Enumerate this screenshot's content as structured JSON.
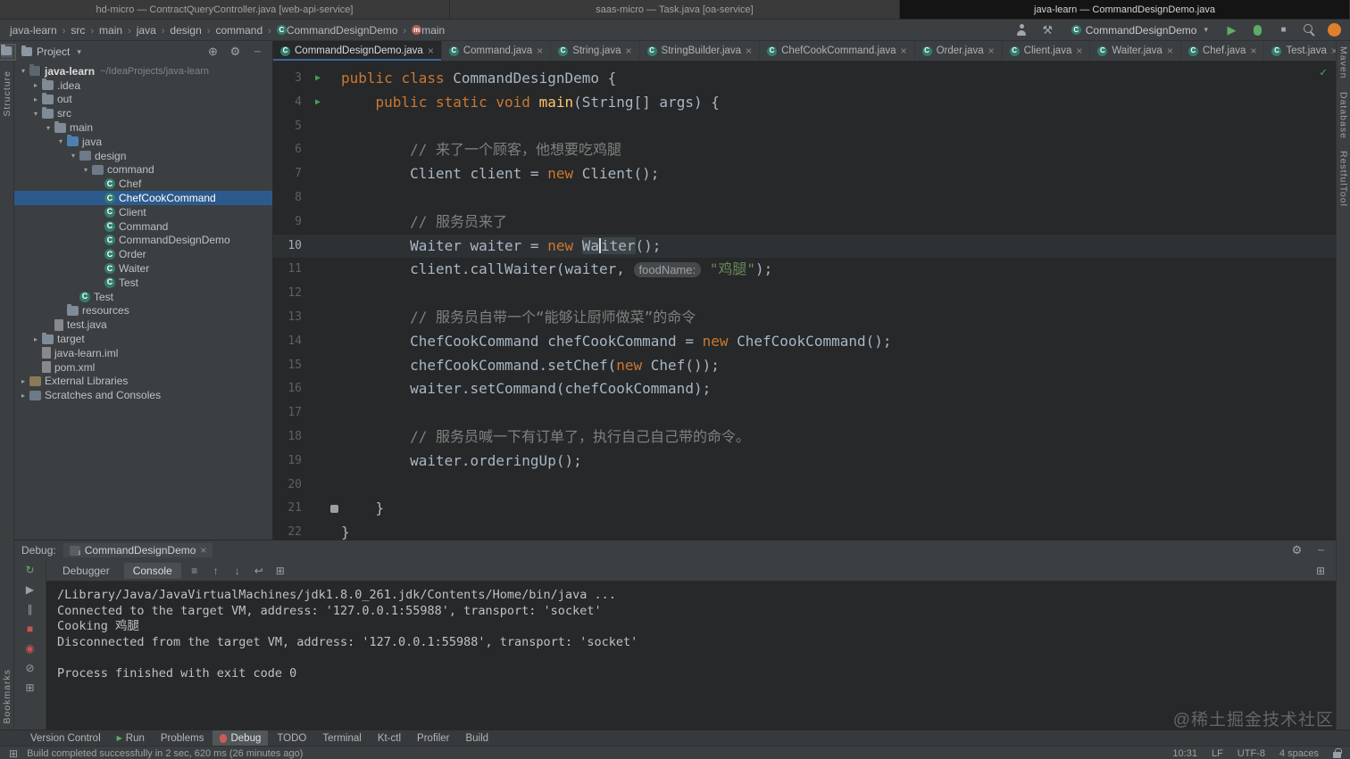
{
  "titlebar": {
    "windows": [
      {
        "label": "hd-micro — ContractQueryController.java [web-api-service]",
        "active": false
      },
      {
        "label": "saas-micro — Task.java [oa-service]",
        "active": false
      },
      {
        "label": "java-learn — CommandDesignDemo.java",
        "active": true
      }
    ]
  },
  "navbar": {
    "breadcrumbs": [
      {
        "label": "java-learn"
      },
      {
        "label": "src"
      },
      {
        "label": "main"
      },
      {
        "label": "java"
      },
      {
        "label": "design"
      },
      {
        "label": "command"
      },
      {
        "label": "CommandDesignDemo",
        "icon": "class"
      },
      {
        "label": "main",
        "icon": "method"
      }
    ],
    "run_config": "CommandDesignDemo"
  },
  "left_strip": {
    "structure_label": "Structure",
    "bookmarks_label": "Bookmarks"
  },
  "right_strip": {
    "labels": [
      "Maven",
      "Database",
      "RestfulTool"
    ]
  },
  "project": {
    "header_label": "Project",
    "tree": [
      {
        "label": "java-learn",
        "hint": "~/IdeaProjects/java-learn",
        "depth": 0,
        "chev": "open",
        "icon": "project",
        "bold": true
      },
      {
        "label": ".idea",
        "depth": 1,
        "chev": "closed",
        "icon": "folder"
      },
      {
        "label": "out",
        "depth": 1,
        "chev": "closed",
        "icon": "folder"
      },
      {
        "label": "src",
        "depth": 1,
        "chev": "open",
        "icon": "folder"
      },
      {
        "label": "main",
        "depth": 2,
        "chev": "open",
        "icon": "folder"
      },
      {
        "label": "java",
        "depth": 3,
        "chev": "open",
        "icon": "folder-src"
      },
      {
        "label": "design",
        "depth": 4,
        "chev": "open",
        "icon": "package"
      },
      {
        "label": "command",
        "depth": 5,
        "chev": "open",
        "icon": "package"
      },
      {
        "label": "Chef",
        "depth": 6,
        "icon": "class"
      },
      {
        "label": "ChefCookCommand",
        "depth": 6,
        "icon": "class",
        "selected": true
      },
      {
        "label": "Client",
        "depth": 6,
        "icon": "class"
      },
      {
        "label": "Command",
        "depth": 6,
        "icon": "class"
      },
      {
        "label": "CommandDesignDemo",
        "depth": 6,
        "icon": "class"
      },
      {
        "label": "Order",
        "depth": 6,
        "icon": "class"
      },
      {
        "label": "Waiter",
        "depth": 6,
        "icon": "class"
      },
      {
        "label": "Test",
        "depth": 6,
        "icon": "class"
      },
      {
        "label": "Test",
        "depth": 4,
        "icon": "class"
      },
      {
        "label": "resources",
        "depth": 3,
        "icon": "folder"
      },
      {
        "label": "test.java",
        "depth": 2,
        "icon": "file"
      },
      {
        "label": "target",
        "depth": 1,
        "chev": "closed",
        "icon": "folder"
      },
      {
        "label": "java-learn.iml",
        "depth": 1,
        "icon": "file"
      },
      {
        "label": "pom.xml",
        "depth": 1,
        "icon": "file"
      },
      {
        "label": "External Libraries",
        "depth": 0,
        "chev": "closed",
        "icon": "lib"
      },
      {
        "label": "Scratches and Consoles",
        "depth": 0,
        "chev": "closed",
        "icon": "scratch"
      }
    ]
  },
  "tabs": [
    {
      "label": "CommandDesignDemo.java",
      "active": true
    },
    {
      "label": "Command.java"
    },
    {
      "label": "String.java"
    },
    {
      "label": "StringBuilder.java"
    },
    {
      "label": "ChefCookCommand.java"
    },
    {
      "label": "Order.java"
    },
    {
      "label": "Client.java"
    },
    {
      "label": "Waiter.java"
    },
    {
      "label": "Chef.java"
    },
    {
      "label": "Test.java"
    }
  ],
  "editor": {
    "lines": [
      {
        "n": 3,
        "g": "run",
        "s": [
          [
            "kw",
            "public "
          ],
          [
            "kw",
            "class "
          ],
          [
            "pl",
            "CommandDesignDemo {"
          ]
        ]
      },
      {
        "n": 4,
        "g": "run",
        "s": [
          [
            "pl",
            "    "
          ],
          [
            "kw",
            "public static void "
          ],
          [
            "mh",
            "main"
          ],
          [
            "pl",
            "(String[] args) {"
          ]
        ]
      },
      {
        "n": 5,
        "s": []
      },
      {
        "n": 6,
        "s": [
          [
            "pl",
            "        "
          ],
          [
            "cm",
            "// 来了一个顾客，他想要吃鸡腿"
          ]
        ]
      },
      {
        "n": 7,
        "s": [
          [
            "pl",
            "        Client client = "
          ],
          [
            "kw",
            "new"
          ],
          [
            "pl",
            " Client();"
          ]
        ]
      },
      {
        "n": 8,
        "s": []
      },
      {
        "n": 9,
        "s": [
          [
            "pl",
            "        "
          ],
          [
            "cm",
            "// 服务员来了"
          ]
        ]
      },
      {
        "n": 10,
        "cur": true,
        "s": [
          [
            "pl",
            "        Waiter waiter = "
          ],
          [
            "kw",
            "new"
          ],
          [
            "pl",
            " "
          ],
          [
            "hl",
            "Wa"
          ],
          [
            "caret",
            ""
          ],
          [
            "hl",
            "iter"
          ],
          [
            "pl",
            "();"
          ]
        ]
      },
      {
        "n": 11,
        "s": [
          [
            "pl",
            "        client.callWaiter(waiter, "
          ],
          [
            "hint",
            "foodName:"
          ],
          [
            "pl",
            " "
          ],
          [
            "st",
            "\"鸡腿\""
          ],
          [
            "pl",
            ");"
          ]
        ]
      },
      {
        "n": 12,
        "s": []
      },
      {
        "n": 13,
        "s": [
          [
            "pl",
            "        "
          ],
          [
            "cm",
            "// 服务员自带一个“能够让厨师做菜”的命令"
          ]
        ]
      },
      {
        "n": 14,
        "s": [
          [
            "pl",
            "        ChefCookCommand chefCookCommand = "
          ],
          [
            "kw",
            "new"
          ],
          [
            "pl",
            " ChefCookCommand();"
          ]
        ]
      },
      {
        "n": 15,
        "s": [
          [
            "pl",
            "        chefCookCommand.setChef("
          ],
          [
            "kw",
            "new"
          ],
          [
            "pl",
            " Chef());"
          ]
        ]
      },
      {
        "n": 16,
        "s": [
          [
            "pl",
            "        waiter.setCommand(chefCookCommand);"
          ]
        ]
      },
      {
        "n": 17,
        "s": []
      },
      {
        "n": 18,
        "s": [
          [
            "pl",
            "        "
          ],
          [
            "cm",
            "// 服务员喊一下有订单了，执行自己自己带的命令。"
          ]
        ]
      },
      {
        "n": 19,
        "s": [
          [
            "pl",
            "        waiter.orderingUp();"
          ]
        ]
      },
      {
        "n": 20,
        "s": []
      },
      {
        "n": 21,
        "g": "mark",
        "s": [
          [
            "pl",
            "    }"
          ]
        ]
      },
      {
        "n": 22,
        "s": [
          [
            "pl",
            "}"
          ]
        ]
      }
    ]
  },
  "debug": {
    "panel_label": "Debug:",
    "session_tab": "CommandDesignDemo",
    "view_tabs": [
      {
        "label": "Debugger"
      },
      {
        "label": "Console",
        "active": true
      }
    ],
    "strip_icons": [
      {
        "name": "rerun-icon",
        "glyph": "↻",
        "color": "#5fad65"
      },
      {
        "name": "resume-icon",
        "glyph": "▶",
        "color": "#9aa0a6"
      },
      {
        "name": "pause-icon",
        "glyph": "∥",
        "color": "#9aa0a6"
      },
      {
        "name": "stop-icon",
        "glyph": "■",
        "color": "#c75450"
      },
      {
        "name": "view-breakpoints-icon",
        "glyph": "◉",
        "color": "#c75450"
      },
      {
        "name": "mute-breakpoints-icon",
        "glyph": "⊘",
        "color": "#9aa0a6"
      },
      {
        "name": "restore-layout-icon",
        "glyph": "⊞",
        "color": "#9aa0a6"
      }
    ],
    "bar_icons": [
      {
        "name": "options-menu-icon",
        "glyph": "≡"
      },
      {
        "name": "scroll-up-icon",
        "glyph": "↑"
      },
      {
        "name": "scroll-down-icon",
        "glyph": "↓"
      },
      {
        "name": "soft-wrap-icon",
        "glyph": "↩"
      },
      {
        "name": "split-icon",
        "glyph": "⊞"
      }
    ],
    "console": [
      "/Library/Java/JavaVirtualMachines/jdk1.8.0_261.jdk/Contents/Home/bin/java ...",
      "Connected to the target VM, address: '127.0.0.1:55988', transport: 'socket'",
      "Cooking 鸡腿",
      "Disconnected from the target VM, address: '127.0.0.1:55988', transport: 'socket'",
      "",
      "Process finished with exit code 0"
    ]
  },
  "toolbar": {
    "buttons": [
      {
        "label": "Version Control"
      },
      {
        "label": "Run",
        "icon": "play"
      },
      {
        "label": "Problems"
      },
      {
        "label": "Debug",
        "icon": "bug",
        "active": true
      },
      {
        "label": "TODO"
      },
      {
        "label": "Terminal"
      },
      {
        "label": "Kt-ctl"
      },
      {
        "label": "Profiler"
      },
      {
        "label": "Build"
      }
    ]
  },
  "statusbar": {
    "message": "Build completed successfully in 2 sec, 620 ms (26 minutes ago)",
    "items": [
      "10:31",
      "LF",
      "UTF-8",
      "4 spaces"
    ]
  },
  "watermark": "@稀土掘金技术社区"
}
